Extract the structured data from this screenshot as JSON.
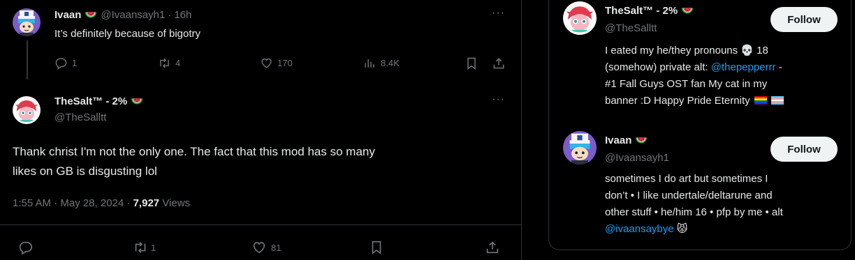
{
  "reply_tweet": {
    "author_name": "Ivaan",
    "author_emoji": "watermelon",
    "handle": "@Ivaansayh1",
    "time": "16h",
    "text": "It’s definitely because of bigotry",
    "replies": "1",
    "reposts": "4",
    "likes": "170",
    "views": "8.4K",
    "more": "···"
  },
  "main_tweet": {
    "author_name": "TheSalt™ - 2%",
    "author_emoji": "watermelon",
    "handle": "@TheSalltt",
    "more": "···",
    "text_line1": "Thank christ I'm not the only one. The fact that this mod has so many",
    "text_line2": "likes on GB is disgusting lol",
    "timestamp": "1:55 AM · May 28, 2024 ·",
    "views_count": "7,927",
    "views_label": "Views",
    "replies": "",
    "reposts": "1",
    "likes": "81"
  },
  "sidebar": {
    "cards": [
      {
        "name": "TheSalt™ - 2%",
        "handle": "@TheSalltt",
        "follow_label": "Follow",
        "bio_line1": "I eated my he/they pronouns",
        "bio_age": "18",
        "bio_line2a": "(somehow) private alt:",
        "bio_mention": "@thepepperrr",
        "bio_dash": "-",
        "bio_line3": "#1 Fall Guys OST fan My cat in my",
        "bio_line4": "banner :D Happy Pride Eternity"
      },
      {
        "name": "Ivaan",
        "handle": "@Ivaansayh1",
        "follow_label": "Follow",
        "bio_line1": "sometimes I do art but sometimes I",
        "bio_line2": "don’t • I like undertale/deltarune and",
        "bio_line3": "other stuff • he/him 16 • pfp by me • alt",
        "bio_mention": "@ivaansaybye"
      }
    ]
  },
  "colors": {
    "background": "#000000",
    "text": "#e7e9ea",
    "muted": "#71767b",
    "link": "#1d9bf0",
    "border": "#2f3336",
    "button_bg": "#eff3f4"
  },
  "icons": [
    "reply-icon",
    "repost-icon",
    "like-icon",
    "views-icon",
    "bookmark-icon",
    "share-icon",
    "more-icon",
    "watermelon-icon",
    "skull-icon",
    "cat-emoji-icon",
    "rainbow-flag-icon",
    "trans-flag-icon"
  ]
}
